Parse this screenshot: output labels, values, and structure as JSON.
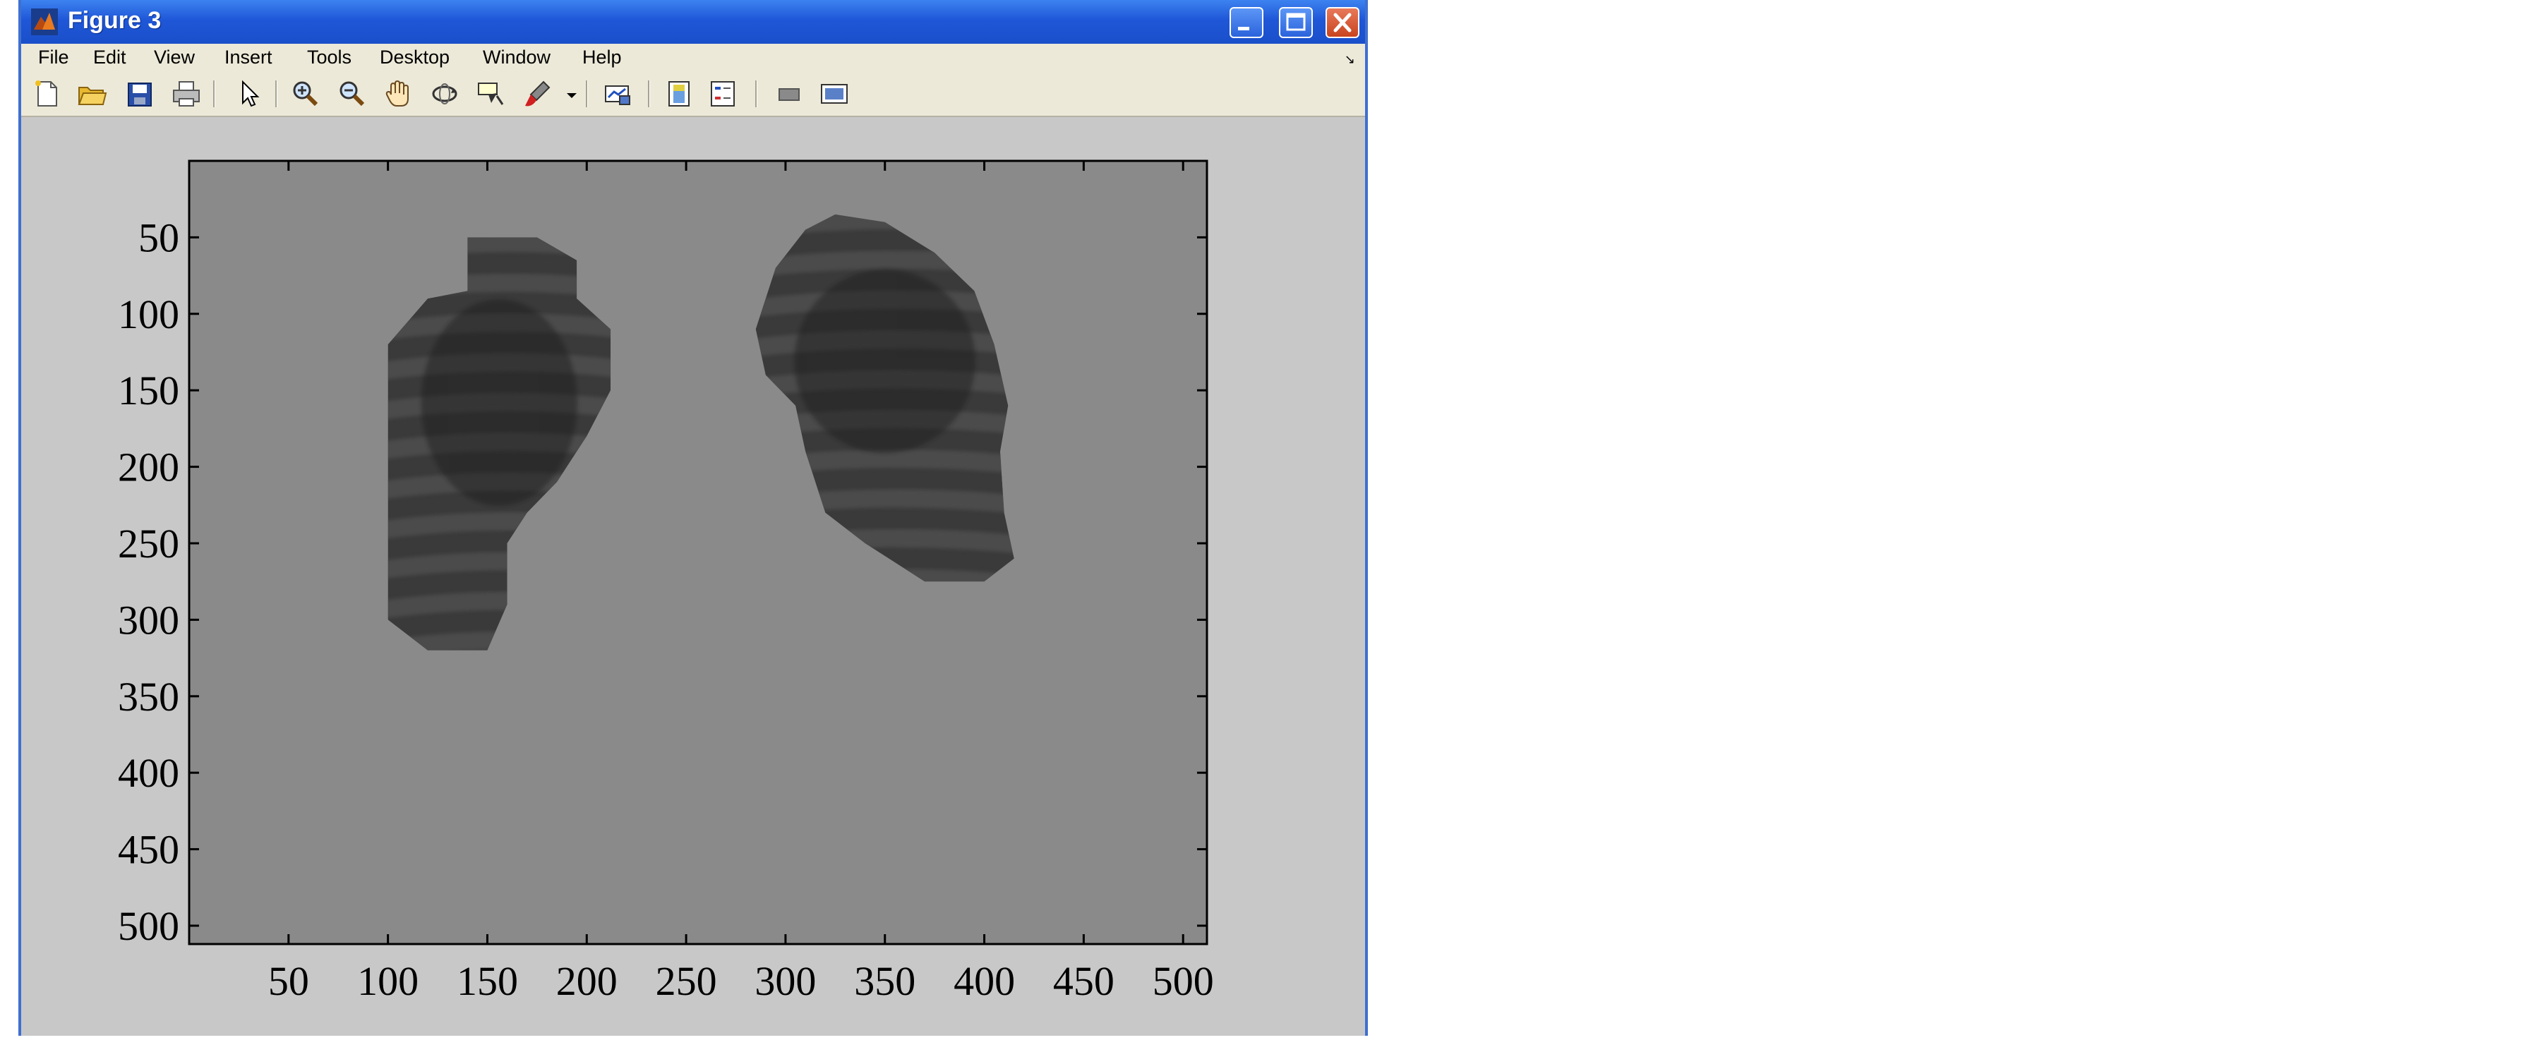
{
  "window": {
    "title": "Figure 3"
  },
  "menu": [
    "File",
    "Edit",
    "View",
    "Insert",
    "Tools",
    "Desktop",
    "Window",
    "Help"
  ],
  "toolbar": {
    "buttons": [
      "new-figure",
      "open-file",
      "save",
      "print",
      "edit-plot",
      "zoom-in",
      "zoom-out",
      "pan",
      "rotate-3d",
      "data-cursor",
      "brush",
      "link-plot",
      "colorbar",
      "legend",
      "hide-plot-tools",
      "show-plot-tools"
    ]
  },
  "image_axes": {
    "xtick_labels": [
      "50",
      "100",
      "150",
      "200",
      "250",
      "300",
      "350",
      "400",
      "450",
      "500"
    ],
    "ytick_labels": [
      "50",
      "100",
      "150",
      "200",
      "250",
      "300",
      "350",
      "400",
      "450",
      "500"
    ],
    "xlim": [
      0,
      512
    ],
    "ylim": [
      0,
      512
    ],
    "y_direction": "reversed",
    "image_content": "segmented chest X-ray lungs on uniform gray background",
    "background_color": "#8a8a8a",
    "lung_color": "#3a3a3a",
    "left_lung_outline": [
      [
        140,
        50
      ],
      [
        175,
        50
      ],
      [
        195,
        65
      ],
      [
        195,
        90
      ],
      [
        212,
        110
      ],
      [
        212,
        150
      ],
      [
        200,
        180
      ],
      [
        185,
        210
      ],
      [
        170,
        230
      ],
      [
        160,
        250
      ],
      [
        160,
        290
      ],
      [
        150,
        320
      ],
      [
        120,
        320
      ],
      [
        100,
        300
      ],
      [
        100,
        120
      ],
      [
        120,
        90
      ],
      [
        140,
        85
      ],
      [
        140,
        65
      ]
    ],
    "right_lung_outline": [
      [
        325,
        35
      ],
      [
        350,
        40
      ],
      [
        375,
        60
      ],
      [
        395,
        85
      ],
      [
        405,
        120
      ],
      [
        412,
        160
      ],
      [
        408,
        190
      ],
      [
        410,
        230
      ],
      [
        415,
        260
      ],
      [
        400,
        275
      ],
      [
        370,
        275
      ],
      [
        340,
        250
      ],
      [
        320,
        230
      ],
      [
        310,
        190
      ],
      [
        305,
        160
      ],
      [
        290,
        140
      ],
      [
        285,
        110
      ],
      [
        295,
        70
      ],
      [
        310,
        45
      ]
    ]
  }
}
